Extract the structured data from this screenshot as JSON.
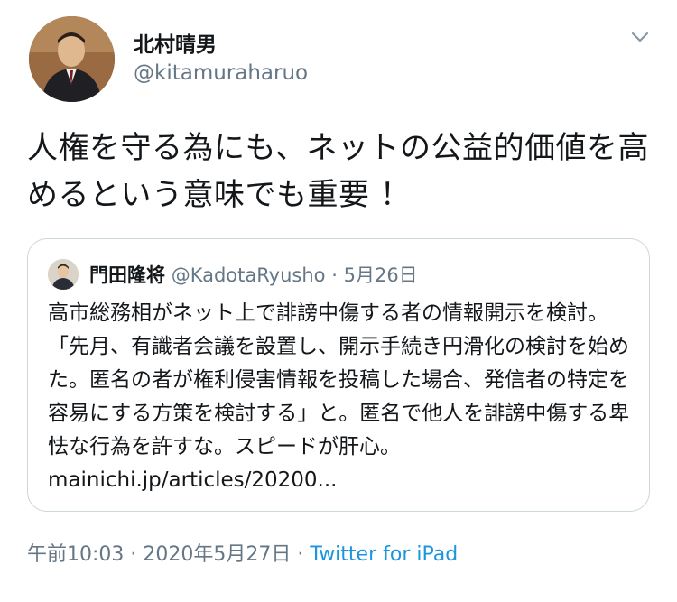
{
  "author": {
    "name": "北村晴男",
    "handle": "@kitamuraharuo"
  },
  "tweet": {
    "text": "人権を守る為にも、ネットの公益的価値を高めるという意味でも重要 ！"
  },
  "quoted": {
    "name": "門田隆将",
    "handle": "@KadotaRyusho",
    "separator": "·",
    "date": "5月26日",
    "text": "高市総務相がネット上で誹謗中傷する者の情報開示を検討。「先月、有識者会議を設置し、開示手続き円滑化の検討を始めた。匿名の者が権利侵害情報を投稿した場合、発信者の特定を容易にする方策を検討する」と。匿名で他人を誹謗中傷する卑怯な行為を許すな。スピードが肝心。mainichi.jp/articles/20200..."
  },
  "footer": {
    "time": "午前10:03",
    "separator1": "·",
    "date": "2020年5月27日",
    "separator2": "·",
    "source": "Twitter for iPad"
  },
  "icons": {
    "menu": "chevron-down-icon"
  },
  "colors": {
    "text": "#14171a",
    "secondary": "#657786",
    "link": "#1b95e0",
    "border": "#ccd6dd"
  }
}
